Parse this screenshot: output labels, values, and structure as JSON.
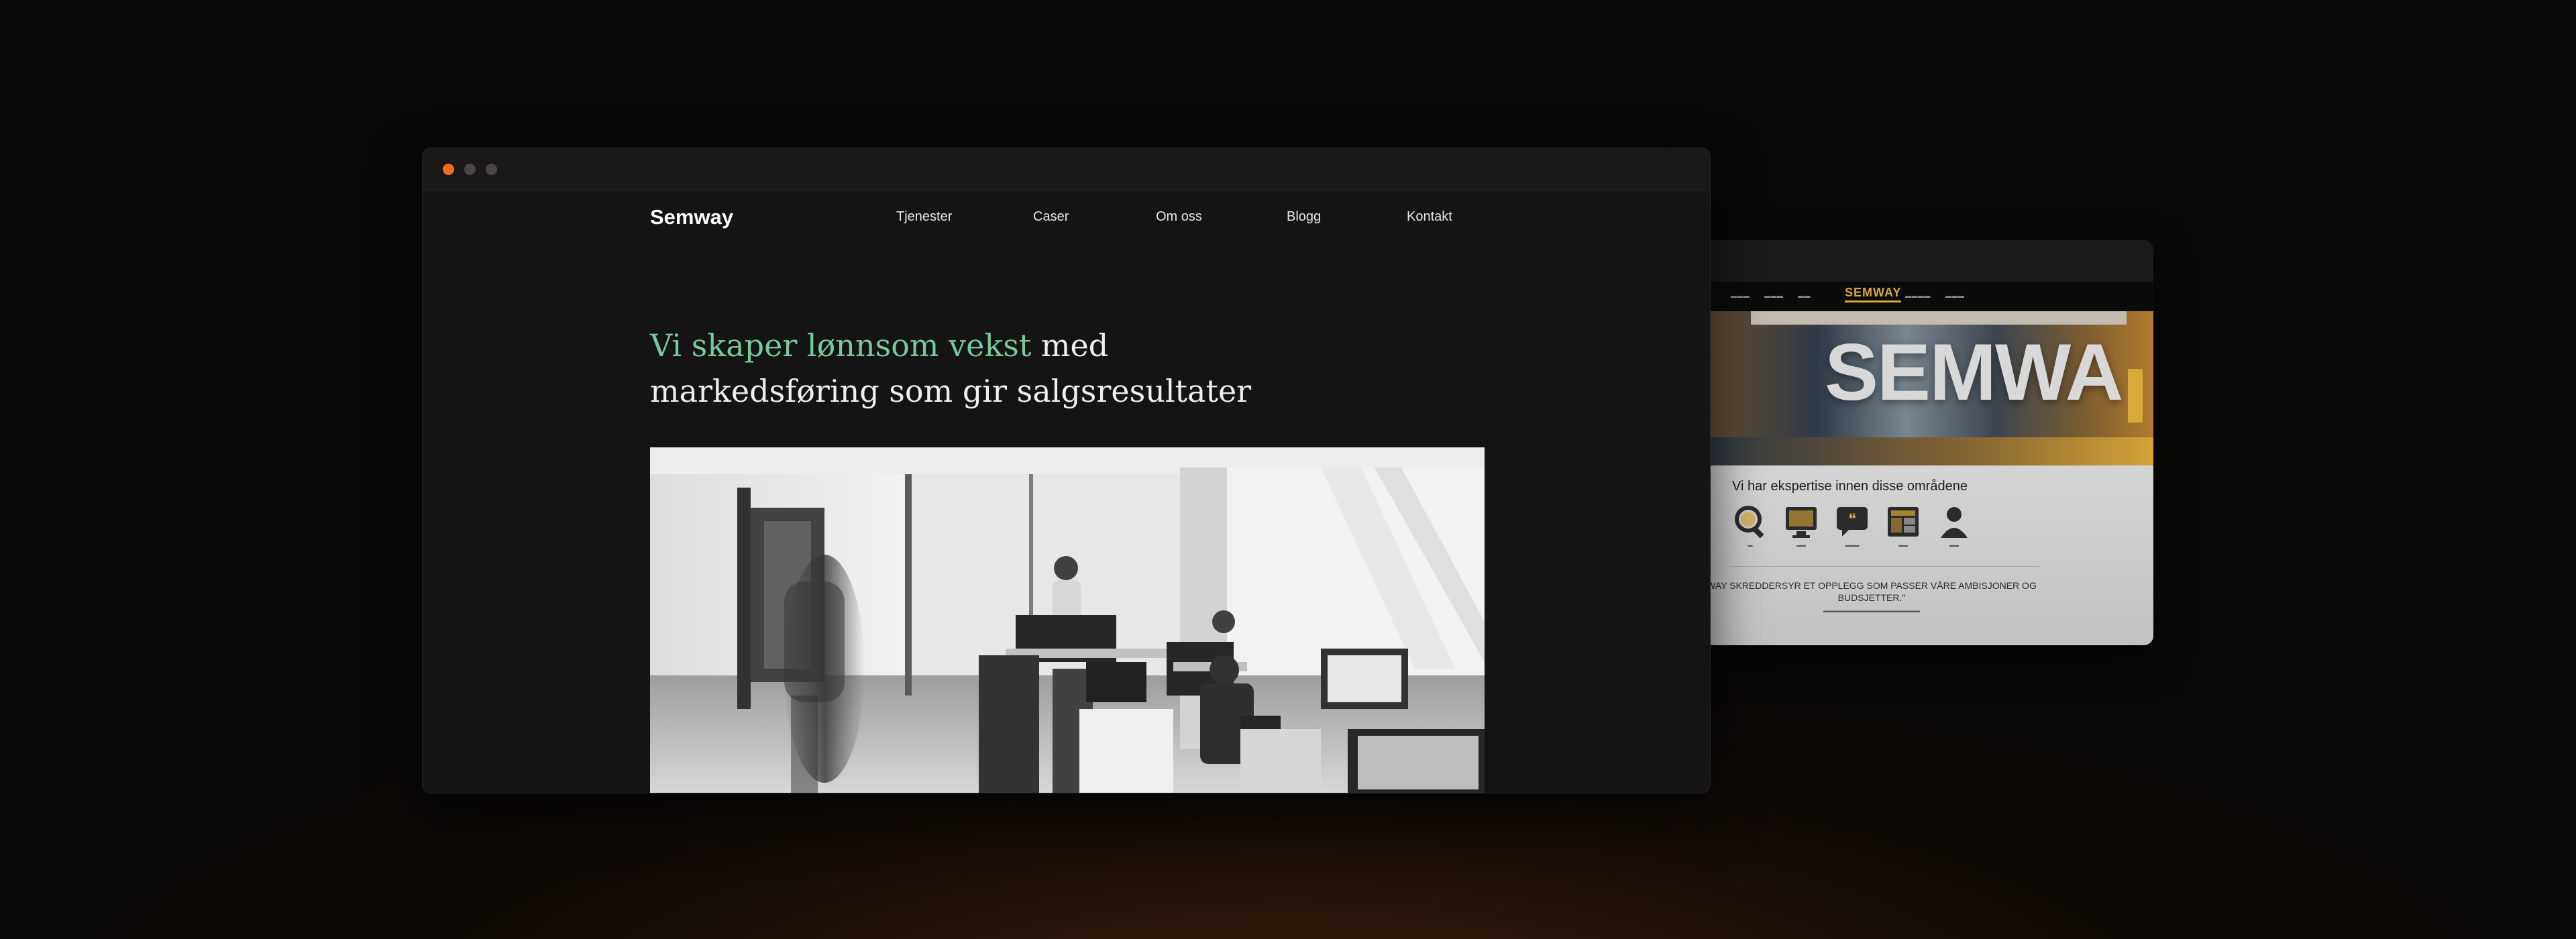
{
  "main_window": {
    "nav": {
      "logo": "Semway",
      "links": [
        "Tjenester",
        "Caser",
        "Om oss",
        "Blogg",
        "Kontakt"
      ]
    },
    "headline": {
      "accent": "Vi skaper lønnsom vekst",
      "rest_line1": " med",
      "line2": "markedsføring som gir salgsresultater"
    },
    "traffic_lights": [
      "#f26b1d",
      "#4a4644",
      "#4a4644"
    ]
  },
  "old_site": {
    "logo": "SEMWAY",
    "hero_word": "SEMWA",
    "heading": "Vi har ekspertise innen disse områdene",
    "quote": "WAY SKREDDERSYR ET OPPLEGG SOM PASSER VÅRE AMBISJONER OG BUDSJETTER.\"",
    "accent_color": "#d9a93a"
  }
}
